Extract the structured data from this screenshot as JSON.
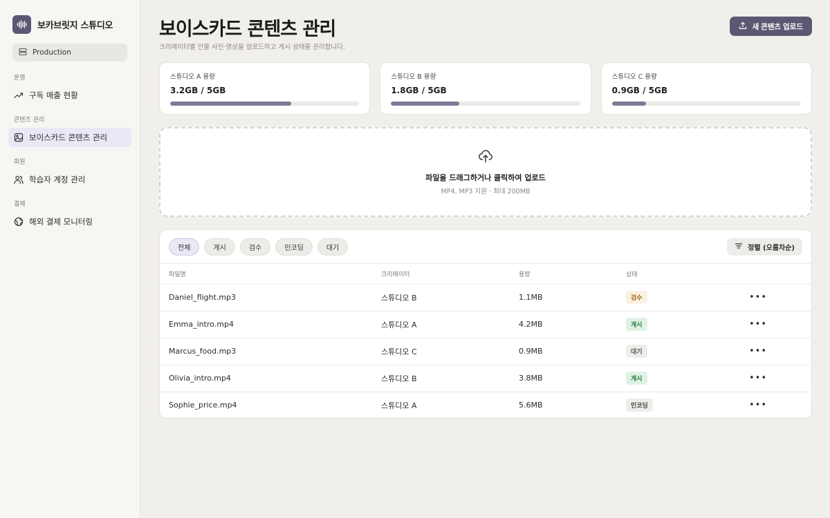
{
  "brand": {
    "name": "보카브릿지 스튜디오"
  },
  "env": {
    "label": "Production"
  },
  "nav": {
    "sections": [
      {
        "heading": "운영",
        "item": "구독 매출 현황"
      },
      {
        "heading": "콘텐츠 관리",
        "item": "보이스카드 콘텐츠 관리"
      },
      {
        "heading": "회원",
        "item": "학습자 계정 관리"
      },
      {
        "heading": "결제",
        "item": "해외 결제 모니터링"
      }
    ]
  },
  "header": {
    "title": "보이스카드 콘텐츠 관리",
    "subtitle": "크리에이터별 인물 사진·영상을 업로드하고 게시 상태를 관리합니다.",
    "upload_label": "새 콘텐츠 업로드"
  },
  "stats": [
    {
      "label": "스튜디오 A 용량",
      "value": "3.2GB / 5GB",
      "fraction": 0.64
    },
    {
      "label": "스튜디오 B 용량",
      "value": "1.8GB / 5GB",
      "fraction": 0.36
    },
    {
      "label": "스튜디오 C 용량",
      "value": "0.9GB / 5GB",
      "fraction": 0.18
    }
  ],
  "dropzone": {
    "title": "파일을 드래그하거나 클릭하여 업로드",
    "subtitle": "MP4, MP3 지원 · 최대 200MB"
  },
  "filters": [
    "전체",
    "게시",
    "검수",
    "인코딩",
    "대기"
  ],
  "sort_label": "정렬 (오름차순)",
  "table": {
    "columns": [
      "파일명",
      "크리에이터",
      "용량",
      "상태"
    ],
    "rows": [
      {
        "file": "Daniel_flight.mp3",
        "creator": "스튜디오 B",
        "size": "1.1MB",
        "status": "검수"
      },
      {
        "file": "Emma_intro.mp4",
        "creator": "스튜디오 A",
        "size": "4.2MB",
        "status": "게시"
      },
      {
        "file": "Marcus_food.mp3",
        "creator": "스튜디오 C",
        "size": "0.9MB",
        "status": "대기"
      },
      {
        "file": "Olivia_intro.mp4",
        "creator": "스튜디오 B",
        "size": "3.8MB",
        "status": "게시"
      },
      {
        "file": "Sophie_price.mp4",
        "creator": "스튜디오 A",
        "size": "5.6MB",
        "status": "인코딩"
      }
    ]
  },
  "colors": {
    "accent": "#5c5873",
    "status_review_bg": "#faf1df",
    "status_review_fg": "#9a6a14",
    "status_published_bg": "#dff2e3",
    "status_published_fg": "#2b7a3d",
    "status_waiting_bg": "#efedea",
    "status_waiting_fg": "#555555",
    "status_encoding_bg": "#efedea",
    "status_encoding_fg": "#444444"
  }
}
